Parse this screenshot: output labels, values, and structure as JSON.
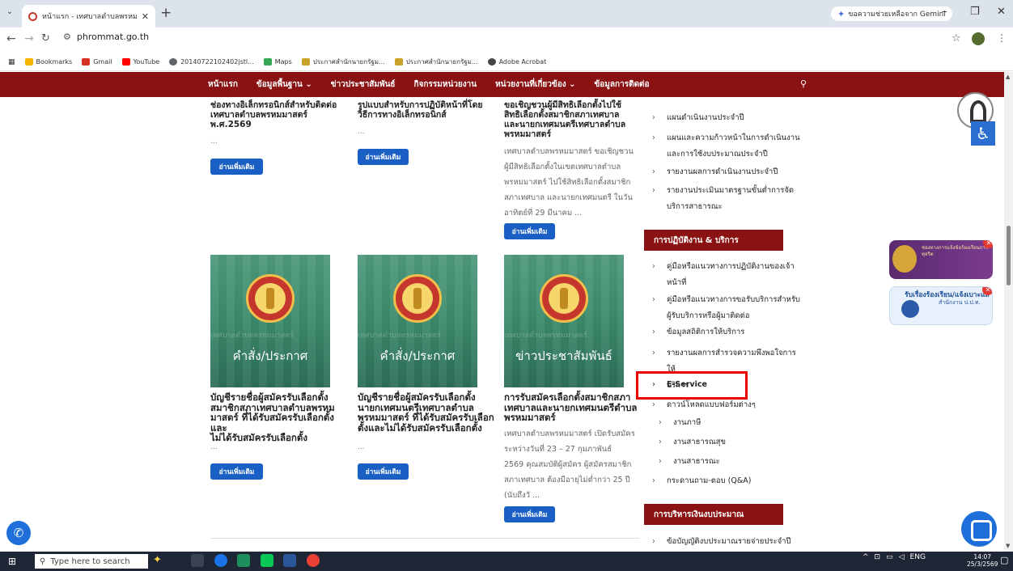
{
  "browser": {
    "tab_title": "หน้าแรก - เทศบาลตำบลพรหมมาศ",
    "tab_close": "✕",
    "new_tab": "+",
    "tab_menu": "⌄",
    "gemini_label": "ขอความช่วยเหลือจาก Gemini",
    "url": "phrommat.go.th",
    "bookmarks": [
      {
        "label": "Bookmarks",
        "color": "#f5b400"
      },
      {
        "label": "Gmail",
        "color": "#d93025"
      },
      {
        "label": "YouTube",
        "color": "#ff0000"
      },
      {
        "label": "20140722102402jstl...",
        "color": "#5f6368"
      },
      {
        "label": "Maps",
        "color": "#34a853"
      },
      {
        "label": "ประกาศสำนักนายกรัฐม...",
        "color": "#c9a227"
      },
      {
        "label": "ประกาศสำนักนายกรัฐม...",
        "color": "#c9a227"
      },
      {
        "label": "Adobe Acrobat",
        "color": "#444444"
      }
    ]
  },
  "nav": {
    "items": [
      "หน้าแรก",
      "ข้อมูลพื้นฐาน ⌄",
      "ข่าวประชาสัมพันธ์",
      "กิจกรรมหน่วยงาน",
      "หน่วยงานที่เกี่ยวข้อง ⌄",
      "ข้อมูลการติดต่อ"
    ],
    "search_icon": "search-icon"
  },
  "col1": {
    "top_title": "ช่องทางอิเล็กทรอนิกส์สำหรับติดต่อ\nเทศบาลตำบลพรหมมาสตร์\nพ.ศ.2569",
    "top_dots": "...",
    "read_more": "อ่านเพิ่มเติม",
    "card_label": "คำสั่ง/ประกาศ",
    "card_ghost": "เทศบาลตำบลพรหมมาสตร์",
    "bottom_title": "บัญชีรายชื่อผู้สมัครรับเลือกตั้ง\nสมาชิกสภาเทศบาลตำบลพรหม\nมาสตร์ ที่ได้รับสมัครรับเลือกตั้งและ\nไม่ได้รับสมัครรับเลือกตั้ง",
    "bottom_dots": "..."
  },
  "col2": {
    "top_title": "รูปแบบสำหรับการปฏิบัติหน้าที่โดย\nวิธีการทางอิเล็กทรอนิกส์",
    "top_dots": "...",
    "read_more": "อ่านเพิ่มเติม",
    "card_label": "คำสั่ง/ประกาศ",
    "card_ghost": "เทศบาลตำบลพรหมมาสตร์",
    "bottom_title": "บัญชีรายชื่อผู้สมัครรับเลือกตั้ง\nนายกเทศมนตรีเทศบาลตำบล\nพรหมมาสตร์ ที่ได้รับสมัครรับเลือก\nตั้งและไม่ได้รับสมัครรับเลือกตั้ง",
    "bottom_dots": "..."
  },
  "col3": {
    "top_title": "ขอเชิญชวนผู้มีสิทธิเลือกตั้งไปใช้\nสิทธิเลือกตั้งสมาชิกสภาเทศบาล\nและนายกเทศมนตรีเทศบาลตำบล\nพรหมมาสตร์",
    "top_excerpt": "เทศบาลตำบลพรหมมาสตร์ ขอเชิญชวน\nผู้มีสิทธิเลือกตั้งในเขตเทศบาลตำบล\nพรหมมาสตร์ ไปใช้สิทธิเลือกตั้งสมาชิก\nสภาเทศบาล และนายกเทศมนตรี ในวัน\nอาทิตย์ที่ 29 มีนาคม ...",
    "read_more": "อ่านเพิ่มเติม",
    "card_label": "ข่าวประชาสัมพันธ์",
    "card_ghost": "เทศบาลตำบลพรหมมาสตร์",
    "bottom_title": "การรับสมัครเลือกตั้งสมาชิกสภา\nเทศบาลและนายกเทศมนตรีตำบล\nพรหมมาสตร์",
    "bottom_excerpt": "เทศบาลตำบลพรหมมาสตร์ เปิดรับสมัคร\nระหว่างวันที่ 23 – 27 กุมภาพันธ์\n2569 คุณสมบัติผู้สมัคร ผู้สมัครสมาชิก\nสภาเทศบาล ต้องมีอายุไม่ต่ำกว่า 25 ปี\n(นับถึงวั ..."
  },
  "sidebar": {
    "top_items": [
      "แผนดำเนินงานประจำปี",
      "แผนและความก้าวหน้าในการดำเนินงาน\nและการใช้งบประมาณประจำปี",
      "รายงานผลการดำเนินงานประจำปี",
      "รายงานประเมินมาตรฐานขั้นต่ำการจัด\nบริการสาธารณะ"
    ],
    "heading_ops": "การปฏิบัติงาน & บริการ",
    "ops_items": [
      "คู่มือหรือแนวทางการปฏิบัติงานของเจ้า\nหน้าที่",
      "คู่มือหรือแนวทางการขอรับบริการสำหรับ\nผู้รับบริการหรือผู้มาติดต่อ",
      "ข้อมูลสถิติการให้บริการ",
      "รายงานผลการสำรวจความพึงพอใจการให้\nบริการ",
      "E-Service",
      "ดาวน์โหลดแบบฟอร์มต่างๆ"
    ],
    "sub_items": [
      "งานภาษี",
      "งานสาธารณสุข",
      "งานสาธารณะ"
    ],
    "qa_item": "กระดานถาม-ตอบ (Q&A)",
    "heading_budget": "การบริหารเงินงบประมาณ",
    "budget_items": [
      "ข้อบัญญัติงบประมาณรายจ่ายประจำปี"
    ],
    "arrow": "›"
  },
  "widgets": {
    "badge1_title": "ช่องทางการแจ้งข้อร้องเรียนการทุจริต",
    "badge2_title": "รับเรื่องร้องเรียน/แจ้งเบาะแส",
    "badge2_sub": "สำนักงาน ป.ป.ท.",
    "close": "✕"
  },
  "taskbar": {
    "search_placeholder": "Type here to search",
    "lang": "ENG",
    "time": "14:07",
    "date": "25/3/2569"
  }
}
